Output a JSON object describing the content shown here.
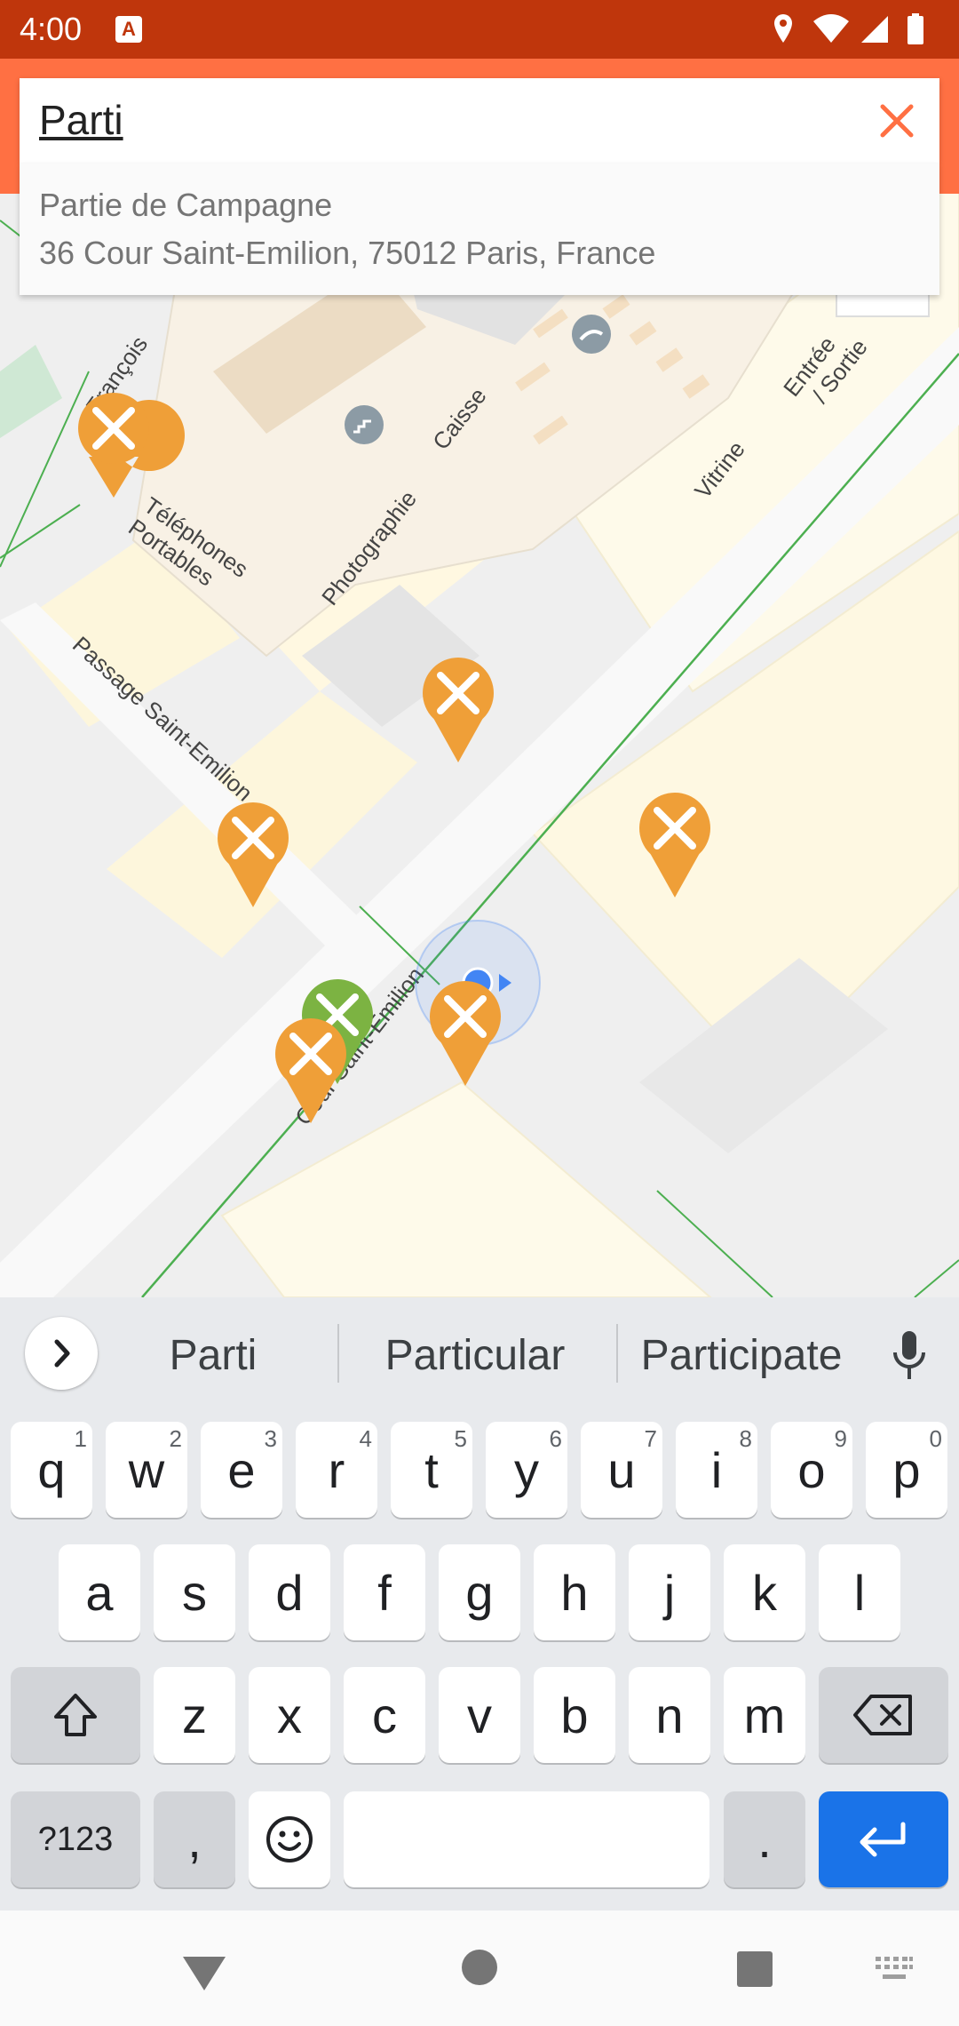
{
  "status_bar": {
    "time": "4:00",
    "notification_icon": "A"
  },
  "search": {
    "query": "Parti",
    "clear_icon": "close-icon"
  },
  "suggestion": {
    "name": "Partie de Campagne",
    "address": "36 Cour Saint-Emilion, 75012 Paris, France"
  },
  "map": {
    "labels": {
      "telephones": "Téléphones Portables",
      "photographie": "Photographie",
      "caisse": "Caisse",
      "vitrine": "Vitrine",
      "entree": "Entrée / Sortie",
      "passage": "Passage Saint-Emilion",
      "cour": "Cour Saint-Emilion",
      "francois": "François"
    }
  },
  "keyboard": {
    "suggestions": [
      "Parti",
      "Particular",
      "Participate"
    ],
    "row1": [
      {
        "k": "q",
        "h": "1"
      },
      {
        "k": "w",
        "h": "2"
      },
      {
        "k": "e",
        "h": "3"
      },
      {
        "k": "r",
        "h": "4"
      },
      {
        "k": "t",
        "h": "5"
      },
      {
        "k": "y",
        "h": "6"
      },
      {
        "k": "u",
        "h": "7"
      },
      {
        "k": "i",
        "h": "8"
      },
      {
        "k": "o",
        "h": "9"
      },
      {
        "k": "p",
        "h": "0"
      }
    ],
    "row2": [
      "a",
      "s",
      "d",
      "f",
      "g",
      "h",
      "j",
      "k",
      "l"
    ],
    "row3": [
      "z",
      "x",
      "c",
      "v",
      "b",
      "n",
      "m"
    ],
    "symbols_label": "?123",
    "comma": ",",
    "period": "."
  },
  "colors": {
    "accent": "#ff7043",
    "status_bar": "#bf360c",
    "poi_orange": "#ef9f38",
    "poi_green": "#7cb342",
    "enter_key": "#1a73e8"
  }
}
